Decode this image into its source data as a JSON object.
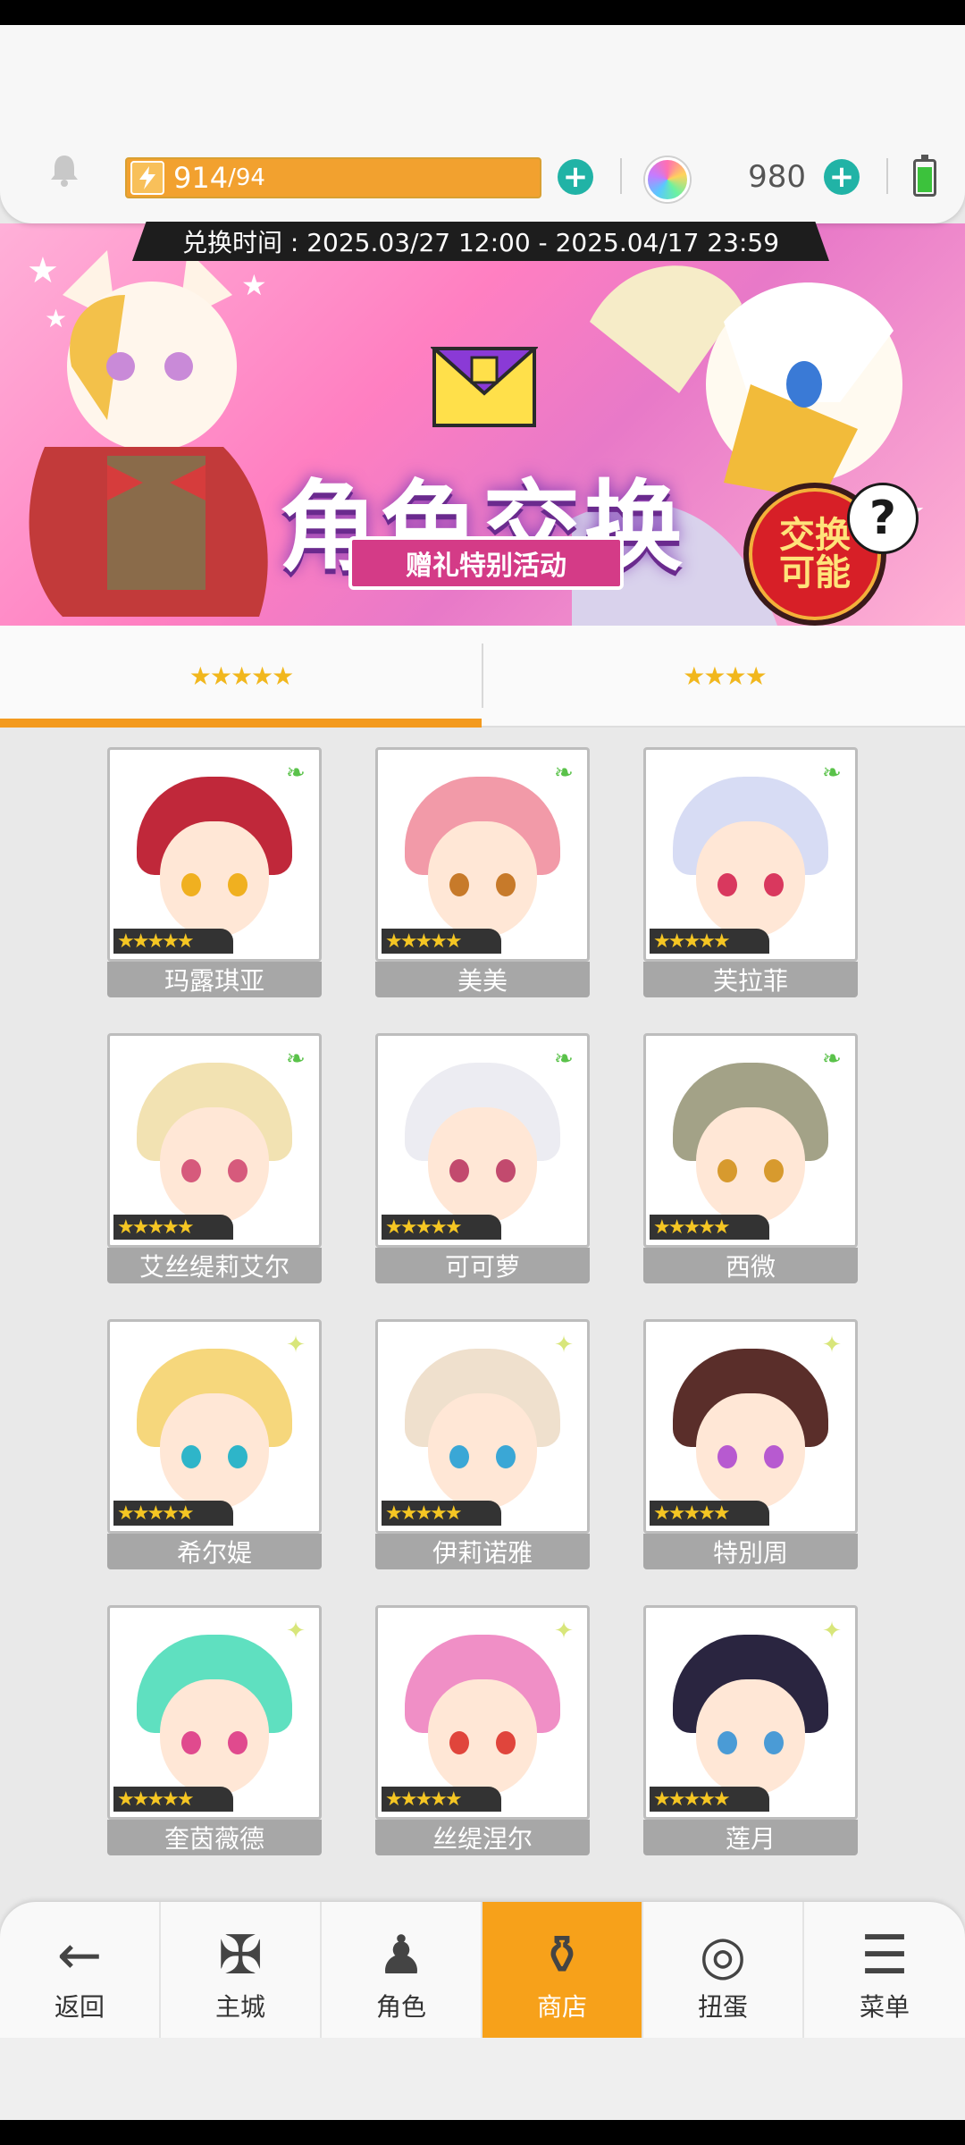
{
  "header": {
    "stamina_current": "914",
    "stamina_max": "/94",
    "gems": "980"
  },
  "banner": {
    "period": "兑换时间 : 2025.03/27 12:00 - 2025.04/17 23:59",
    "title": "角色交换",
    "subtitle": "赠礼特别活动",
    "badge": "交换\n可能",
    "help": "?"
  },
  "tabs": [
    {
      "label": "★★★★★",
      "active": true
    },
    {
      "label": "★★★★",
      "active": false
    }
  ],
  "characters": [
    {
      "name": "玛露琪亚",
      "rarity": "★★★★★",
      "element": "leaf",
      "hair": "#c0283a",
      "eye": "#f0b020"
    },
    {
      "name": "美美",
      "rarity": "★★★★★",
      "element": "leaf",
      "hair": "#f29aa8",
      "eye": "#c77a2a"
    },
    {
      "name": "芙拉菲",
      "rarity": "★★★★★",
      "element": "leaf",
      "hair": "#d7dcf4",
      "eye": "#d9385e"
    },
    {
      "name": "艾丝缇莉艾尔",
      "rarity": "★★★★★",
      "element": "leaf",
      "hair": "#f2e2b2",
      "eye": "#d65a7c"
    },
    {
      "name": "可可萝",
      "rarity": "★★★★★",
      "element": "leaf",
      "hair": "#ececf2",
      "eye": "#c24a6e"
    },
    {
      "name": "西微",
      "rarity": "★★★★★",
      "element": "leaf",
      "hair": "#a3a287",
      "eye": "#d79a2e"
    },
    {
      "name": "希尔媞",
      "rarity": "★★★★★",
      "element": "light",
      "hair": "#f6d77c",
      "eye": "#2eb5c9"
    },
    {
      "name": "伊莉诺雅",
      "rarity": "★★★★★",
      "element": "light",
      "hair": "#efe0cd",
      "eye": "#3aa7d6"
    },
    {
      "name": "特別周",
      "rarity": "★★★★★",
      "element": "light",
      "hair": "#5a2e2a",
      "eye": "#b75ad0"
    },
    {
      "name": "奎茵薇德",
      "rarity": "★★★★★",
      "element": "light",
      "hair": "#5fe0c0",
      "eye": "#e04a8e"
    },
    {
      "name": "丝缇涅尔",
      "rarity": "★★★★★",
      "element": "light",
      "hair": "#f08fc6",
      "eye": "#e0453c"
    },
    {
      "name": "莲月",
      "rarity": "★★★★★",
      "element": "light",
      "hair": "#2a2540",
      "eye": "#4a9bd6"
    }
  ],
  "nav": [
    {
      "label": "返回",
      "icon": "←",
      "active": false
    },
    {
      "label": "主城",
      "icon": "✠",
      "active": false
    },
    {
      "label": "角色",
      "icon": "♟",
      "active": false
    },
    {
      "label": "商店",
      "icon": "⚱",
      "active": true
    },
    {
      "label": "扭蛋",
      "icon": "◎",
      "active": false
    },
    {
      "label": "菜单",
      "icon": "☰",
      "active": false
    }
  ],
  "colors": {
    "accent": "#f39a1e",
    "plus": "#21b3a6"
  }
}
